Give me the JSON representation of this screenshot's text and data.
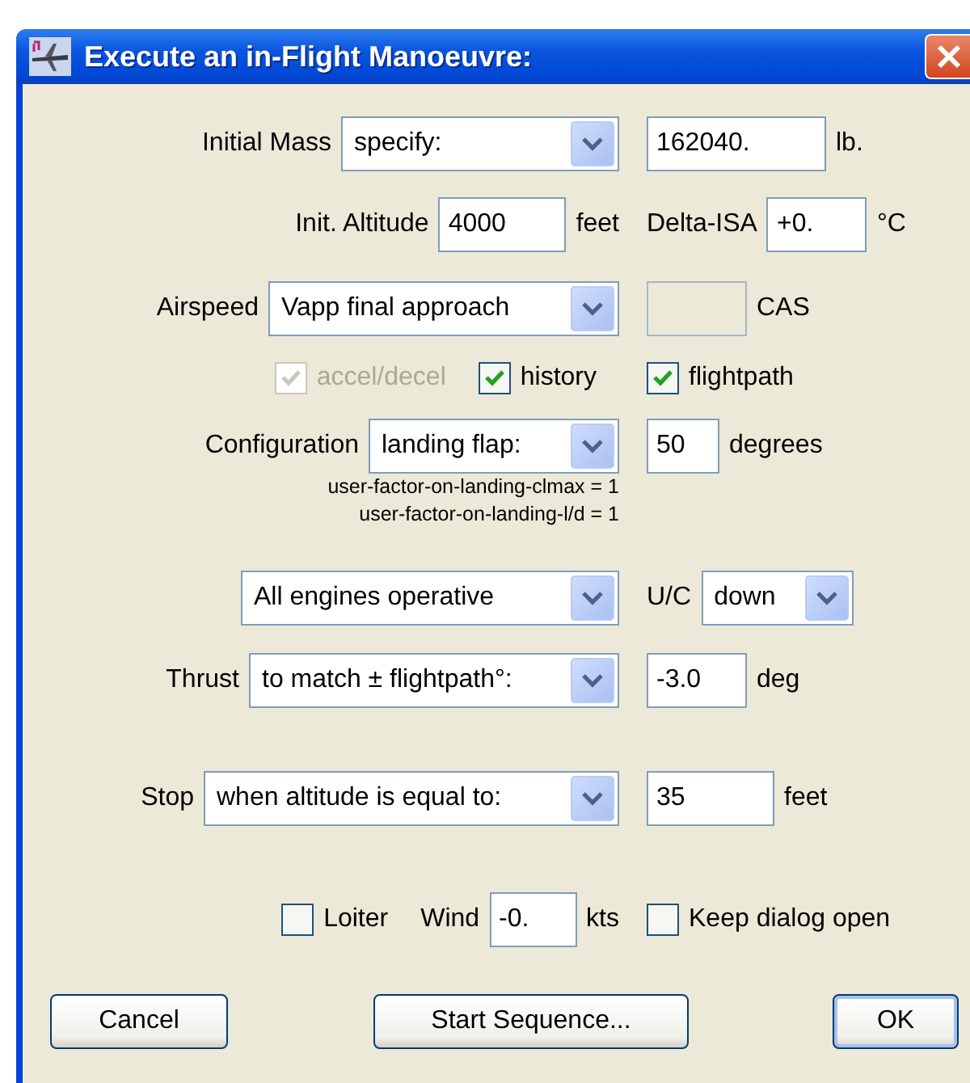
{
  "window": {
    "title": "Execute an in-Flight Manoeuvre:"
  },
  "rows": [
    {
      "left": [
        {
          "kind": "label",
          "text": "Initial Mass"
        },
        {
          "kind": "combo",
          "value": "specify:"
        }
      ],
      "right": [
        {
          "kind": "field",
          "value": "162040."
        },
        {
          "kind": "label",
          "text": "lb."
        }
      ]
    },
    {
      "left": [
        {
          "kind": "label",
          "text": "Init. Altitude"
        },
        {
          "kind": "field",
          "value": "4000"
        },
        {
          "kind": "label",
          "text": "feet"
        }
      ],
      "right": [
        {
          "kind": "label",
          "text": "Delta-ISA"
        },
        {
          "kind": "field",
          "value": "+0."
        },
        {
          "kind": "label",
          "text": "°C"
        }
      ]
    },
    {
      "left": [
        {
          "kind": "label",
          "text": "Airspeed"
        },
        {
          "kind": "combo",
          "value": "Vapp final approach"
        }
      ],
      "right": [
        {
          "kind": "field",
          "disabled": true
        },
        {
          "kind": "label",
          "text": "CAS"
        }
      ]
    },
    {
      "left": [
        {
          "kind": "checkbox",
          "label": "accel/decel",
          "checked": true,
          "disabled": true
        },
        {
          "kind": "checkbox",
          "label": "history",
          "checked": true,
          "disabled": false
        }
      ],
      "right": [
        {
          "kind": "checkbox",
          "label": "flightpath",
          "checked": true,
          "disabled": false
        }
      ]
    },
    {
      "left": [
        {
          "kind": "label",
          "text": "Configuration"
        },
        {
          "kind": "combo",
          "value": "landing flap:"
        }
      ],
      "right": [
        {
          "kind": "field",
          "value": "50"
        },
        {
          "kind": "label",
          "text": "degrees"
        }
      ]
    },
    {
      "left": [
        {
          "kind": "note",
          "text": "user-factor-on-landing-clmax = 1"
        },
        {
          "kind": "note",
          "text": "user-factor-on-landing-l/d = 1"
        }
      ],
      "right": []
    },
    {
      "left": [
        {
          "kind": "combo",
          "value": "All engines operative"
        }
      ],
      "right": [
        {
          "kind": "label",
          "text": "U/C"
        },
        {
          "kind": "combo",
          "value": "down"
        }
      ]
    },
    {
      "left": [
        {
          "kind": "label",
          "text": "Thrust"
        },
        {
          "kind": "combo",
          "value": "to match ± flightpath°:"
        }
      ],
      "right": [
        {
          "kind": "field",
          "value": "-3.0"
        },
        {
          "kind": "label",
          "text": "deg"
        }
      ]
    },
    {
      "left": [
        {
          "kind": "label",
          "text": "Stop"
        },
        {
          "kind": "combo",
          "value": "when altitude is equal to:"
        }
      ],
      "right": [
        {
          "kind": "field",
          "value": "35"
        },
        {
          "kind": "label",
          "text": "feet"
        }
      ]
    },
    {
      "left": [
        {
          "kind": "checkbox",
          "label": "Loiter",
          "checked": false,
          "disabled": false
        },
        {
          "kind": "label",
          "text": "Wind"
        },
        {
          "kind": "field",
          "value": "-0."
        },
        {
          "kind": "label",
          "text": "kts"
        }
      ],
      "right": [
        {
          "kind": "checkbox",
          "label": "Keep dialog open",
          "checked": false,
          "disabled": false
        }
      ]
    }
  ],
  "buttons": [
    {
      "label": "Cancel",
      "default": false
    },
    {
      "label": "Start Sequence...",
      "default": false
    },
    {
      "label": "OK",
      "default": true
    }
  ]
}
